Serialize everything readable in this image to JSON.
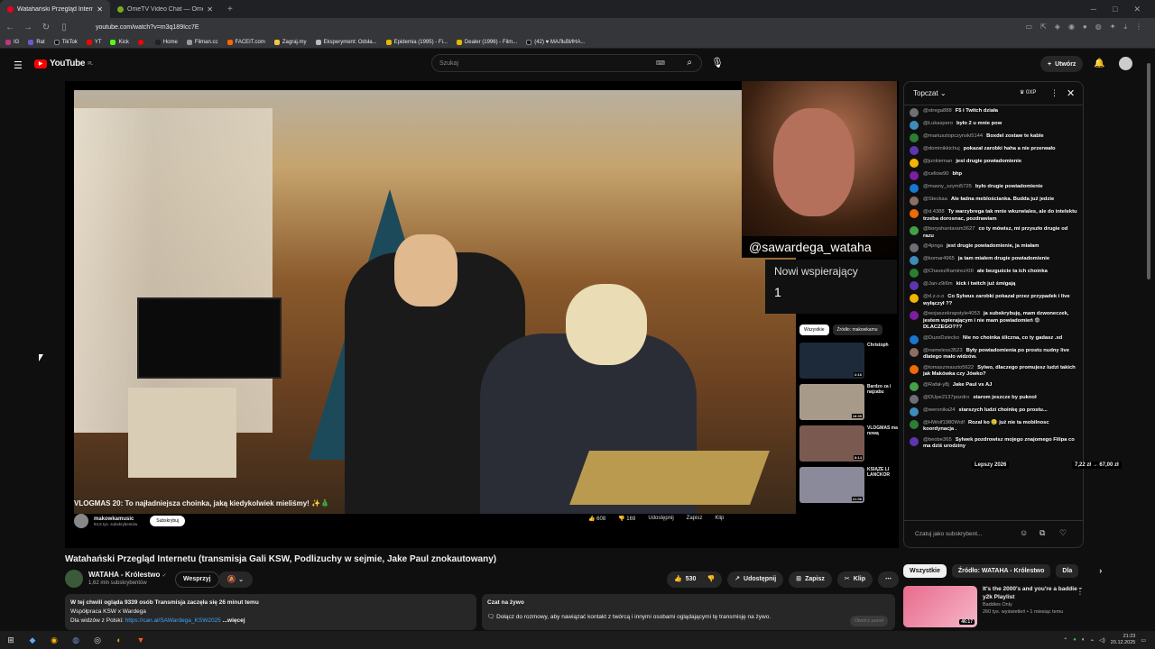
{
  "browser": {
    "tabs": [
      {
        "label": "Watahański Przegląd Internet",
        "active": true
      },
      {
        "label": "OmeTV Video Chat — Omegle R",
        "active": false
      }
    ],
    "url": "youtube.com/watch?v=m3q189Icc7E",
    "bookmarks": [
      "IG",
      "Rat",
      "TikTok",
      "YT",
      "Kick",
      "",
      "Home",
      "Filman.cc",
      "FACEIT.com",
      "Zagraj.my",
      "Eksperyment: Odsła...",
      "Epidemia (1995) - Fi...",
      "Dealer (1996) - Film...",
      "(42) ♥ МАЛЬВИНА..."
    ]
  },
  "header": {
    "logo": "YouTube",
    "logo_region": "PL",
    "search_placeholder": "Szukaj",
    "create_label": "Utwórz"
  },
  "player": {
    "webcam_name": "@sawardega_wataha",
    "new_supporters_label": "Nowi wspierający",
    "new_supporters_count": "1",
    "inner_title": "VLOGMAS 20: To najładniejsza choinka, jaką kiedykolwiek mieliśmy! ✨🎄",
    "inner_channel": "makowkamusic",
    "inner_subs": "94,5 tys. subskrybentów",
    "inner_subscribe": "Subskrybuj",
    "inner_actions": {
      "likes": "608",
      "dislikes": "169",
      "share": "Udostępnij",
      "save": "Zapisz",
      "clip": "Klip"
    },
    "inner_filters": [
      "Wszystkie",
      "Źródło: makowkamu"
    ],
    "inner_recs": [
      {
        "title": "Christoph",
        "duration": "2:16"
      },
      {
        "title": "Bardzo za i najzabu",
        "duration": "18:35"
      },
      {
        "title": "VLOGMAS ma nową",
        "duration": "8:14"
      },
      {
        "title": "KSIĄŻE LI LANCKOR",
        "duration": "21:06"
      }
    ]
  },
  "video": {
    "title": "Watahański Przegląd Internetu (transmisja Gali KSW, Podlizuchy w sejmie, Jake Paul znokautowany)",
    "channel": "WATAHA - Królestwo",
    "subscribers": "1,62 mln subskrybentów",
    "support_label": "Wesprzyj",
    "likes": "530",
    "share_label": "Udostępnij",
    "save_label": "Zapisz",
    "clip_label": "Klip"
  },
  "description": {
    "line1": "W tej chwili ogląda 9339 osób  Transmisja zaczęła się 26 minut temu",
    "line2": "Współpraca KSW x Wardega",
    "line3_prefix": "Dla widzów z Polski: ",
    "line3_link": "https://can.al/SAWardega_KSW2025",
    "more": "...więcej"
  },
  "live_chat_box": {
    "title": "Czat na żywo",
    "text": "Dołącz do rozmowy, aby nawiązać kontakt z twórcą i innymi osobami oglądającymi tę transmisję na żywo.",
    "button": "Otwórz panel"
  },
  "chat": {
    "mode": "Topczat",
    "xp": "0XP",
    "input_placeholder": "Czatuj jako subskrybent...",
    "messages": [
      {
        "author": "@strega888",
        "text": "F5 i Twitch działa"
      },
      {
        "author": "@Lukaspero",
        "text": "było 2 u mnie pow"
      },
      {
        "author": "@mariusztopczynski5144",
        "text": "Boxdel zostaw te kable"
      },
      {
        "author": "@dominikkichuj",
        "text": "pokazał zarobki haha a nie przerwało"
      },
      {
        "author": "@junkieman",
        "text": "jest drugie powiadomienie"
      },
      {
        "author": "@cellow90",
        "text": "bhp"
      },
      {
        "author": "@masny_szymi5725",
        "text": "było drugie powiadomienie"
      },
      {
        "author": "@Steckaa",
        "text": "Ale ładna meblościanka. Budda już jedzie"
      },
      {
        "author": "@d.4388",
        "text": "Ty warzybrega tak mnie wkurwiales, ale do intelektu trzeba dorosnac, pozdrawiam"
      },
      {
        "author": "@boryshantaram3627",
        "text": "co ty mówisz, mi przyszło drugie od razu"
      },
      {
        "author": "@4pnga",
        "text": "jest drugie powiadomienie, ja miałam"
      },
      {
        "author": "@komar4965",
        "text": "ja tam miałem drugie powiadomienie"
      },
      {
        "author": "@ChavezRamirezXIII",
        "text": "ale bezguście ta ich choinka"
      },
      {
        "author": "@Jan-z9i6m",
        "text": "kick i twitch już śmigają"
      },
      {
        "author": "@d.z.o.o",
        "text": "Co Sylwus zarobki pokazał przez przypadek i live wyłączył ??"
      },
      {
        "author": "@wojaszekrapstyle4053",
        "text": "ja subskrybuję, mam dzwoneczek, jestem wpierającym i nie mam powiadomień 😨 DLACZEGO???"
      },
      {
        "author": "@DuzeDziecko",
        "text": "Nie no choinka śliczna, co ty gadasz .xd"
      },
      {
        "author": "@nameless3523",
        "text": "Były powiadomienia po prostu nudny live dlatego mało widzów."
      },
      {
        "author": "@tomaszmaszto5622",
        "text": "Sylwo, dlaczego promujesz ludzi takich jak Makówka czy Jówko?"
      },
      {
        "author": "@Rafał-y8j",
        "text": "Jake Paul vs AJ"
      },
      {
        "author": "@DUpe2137pozdro",
        "text": "starom jeszcze by puknoł"
      },
      {
        "author": "@weronika24",
        "text": "starszych ludzi choinkę po prostu..."
      },
      {
        "author": "@HWolf1980Wolf",
        "text": "Rozal ko 🥲 już nie ta mobilnosc koordynacja ."
      },
      {
        "author": "@beobe365",
        "text": "Sylwek pozdrowisz mojego znajomego Filipa co ma dziś urodziny"
      }
    ],
    "overlay_left": "Lepszy 2026",
    "overlay_price": "7,22 zł → 67,00 zł"
  },
  "sidebar": {
    "filters": [
      "Wszystkie",
      "Źródło: WATAHA - Królestwo",
      "Dla"
    ],
    "video": {
      "title": "It's the 2000's and you're a baddie ~ y2k Playlist",
      "channel": "Baddies Only",
      "meta": "260 tys. wyświetleń • 1 miesiąc temu",
      "duration": "46:17"
    }
  },
  "taskbar": {
    "time": "21:23",
    "date": "20.12.2025"
  }
}
